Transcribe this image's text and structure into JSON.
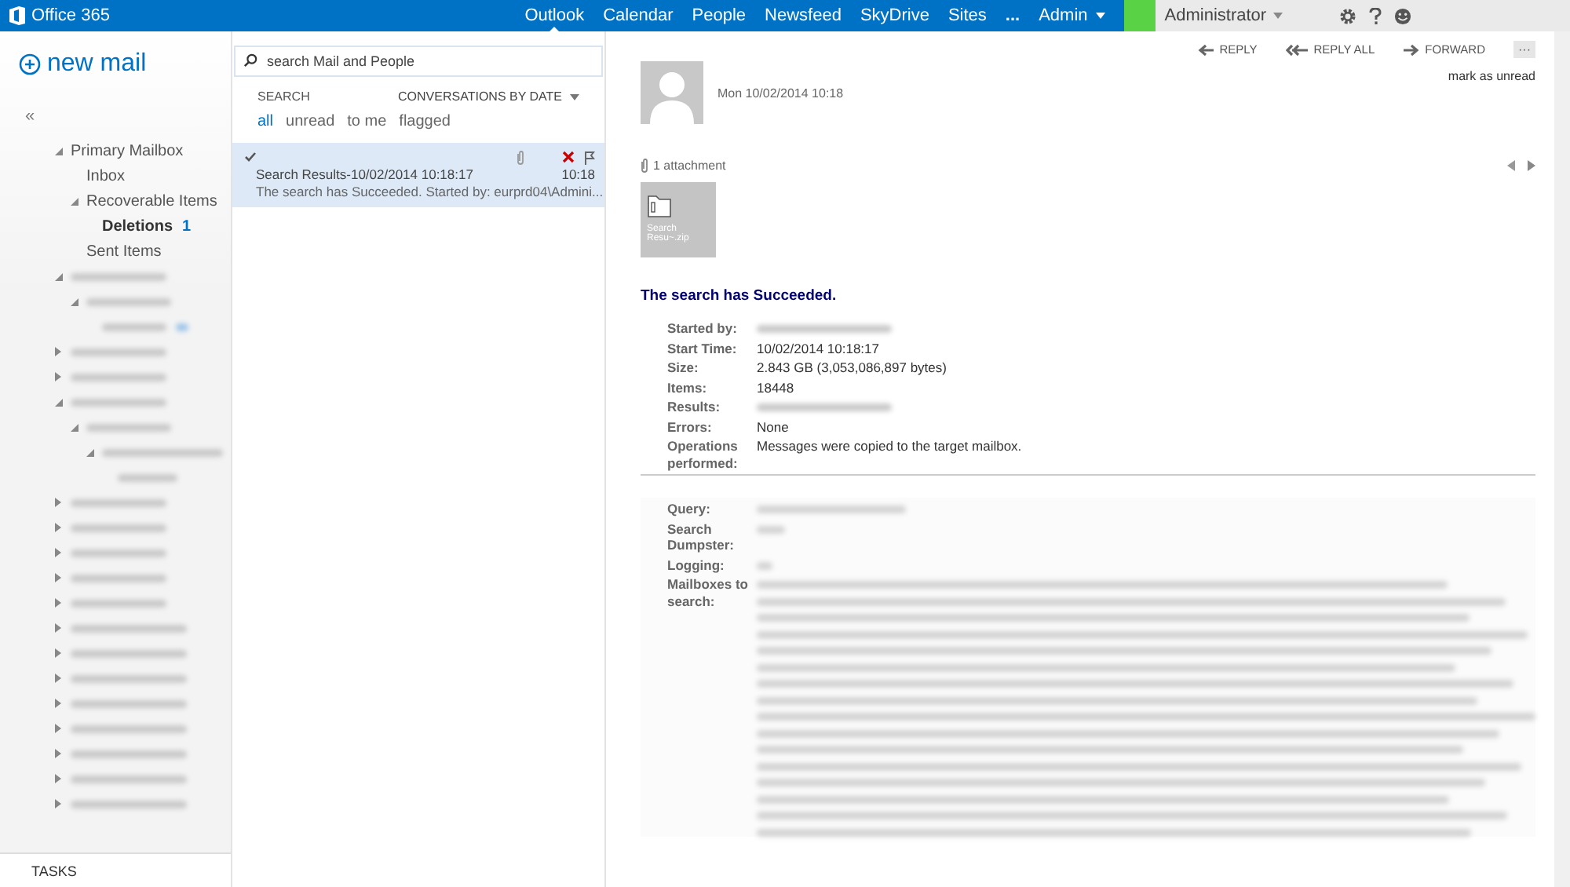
{
  "topbar": {
    "logo": "Office 365",
    "nav": [
      {
        "label": "Outlook",
        "selected": true
      },
      {
        "label": "Calendar",
        "selected": false
      },
      {
        "label": "People",
        "selected": false
      },
      {
        "label": "Newsfeed",
        "selected": false
      },
      {
        "label": "SkyDrive",
        "selected": false
      },
      {
        "label": "Sites",
        "selected": false
      },
      {
        "label": "...",
        "selected": false
      },
      {
        "label": "Admin",
        "selected": false
      }
    ],
    "user": "Administrator"
  },
  "sidebar": {
    "new_mail": "new mail",
    "collapse": "«",
    "folders": [
      {
        "kind": "folder",
        "label": "Primary Mailbox",
        "expanded": true,
        "children": [
          {
            "kind": "folder",
            "label": "Inbox"
          },
          {
            "kind": "folder",
            "label": "Recoverable Items",
            "expanded": true,
            "children": [
              {
                "kind": "folder",
                "label": "Deletions",
                "count": "1",
                "selected": true
              }
            ]
          },
          {
            "kind": "folder",
            "label": "Sent Items"
          }
        ]
      },
      {
        "kind": "redacted",
        "expanded": true,
        "children": [
          {
            "kind": "redacted",
            "expanded": true,
            "children": [
              {
                "kind": "redacted",
                "badge": true
              }
            ]
          }
        ]
      },
      {
        "kind": "redacted",
        "expanded": false
      },
      {
        "kind": "redacted",
        "expanded": false
      },
      {
        "kind": "redacted",
        "expanded": true,
        "children": [
          {
            "kind": "redacted",
            "expanded": true,
            "children": [
              {
                "kind": "redacted",
                "expanded": true,
                "children": [
                  {
                    "kind": "redacted"
                  }
                ]
              }
            ]
          }
        ]
      },
      {
        "kind": "redacted",
        "expanded": false
      },
      {
        "kind": "redacted",
        "expanded": false
      },
      {
        "kind": "redacted",
        "expanded": false
      },
      {
        "kind": "redacted",
        "expanded": false
      },
      {
        "kind": "redacted",
        "expanded": false
      },
      {
        "kind": "redacted",
        "expanded": false
      },
      {
        "kind": "redacted",
        "expanded": false
      },
      {
        "kind": "redacted",
        "expanded": false
      },
      {
        "kind": "redacted",
        "expanded": false
      },
      {
        "kind": "redacted",
        "expanded": false
      },
      {
        "kind": "redacted",
        "expanded": false
      },
      {
        "kind": "redacted",
        "expanded": false
      },
      {
        "kind": "redacted",
        "expanded": false
      }
    ],
    "tasks": "TASKS"
  },
  "message_list": {
    "search": {
      "placeholder": "search Mail and People"
    },
    "heading": "SEARCH",
    "sort": "CONVERSATIONS BY DATE",
    "filters": [
      {
        "label": "all",
        "selected": true
      },
      {
        "label": "unread",
        "selected": false
      },
      {
        "label": "to me",
        "selected": false
      },
      {
        "label": "flagged",
        "selected": false
      }
    ],
    "messages": [
      {
        "subject": "Search Results-10/02/2014 10:18:17",
        "time": "10:18",
        "preview": "The search has Succeeded.  Started by: eurprd04\\Admini...",
        "selected": true,
        "read": true,
        "attachment": true
      }
    ]
  },
  "reading_pane": {
    "actions": [
      "REPLY",
      "REPLY ALL",
      "FORWARD"
    ],
    "mark_unread": "mark as unread",
    "date": "Mon 10/02/2014 10:18",
    "attachments_label": "1 attachment",
    "attachment": "Search Resu~.zip",
    "heading": "The search has Succeeded.",
    "details": [
      {
        "label": "Started by:",
        "kind": "redacted"
      },
      {
        "label": "Start Time:",
        "kind": "text",
        "value": "10/02/2014 10:18:17"
      },
      {
        "label": "Size:",
        "kind": "text",
        "value": "2.843 GB (3,053,086,897 bytes)"
      },
      {
        "label": "Items:",
        "kind": "text",
        "value": "18448"
      },
      {
        "label": "Results:",
        "kind": "redacted"
      },
      {
        "label": "Errors:",
        "kind": "text",
        "value": "None"
      },
      {
        "label": "Operations performed:",
        "kind": "text",
        "value": "Messages were copied to the target mailbox."
      }
    ],
    "query": [
      {
        "label": "Query:",
        "kind": "line"
      },
      {
        "label": "Search Dumpster:",
        "kind": "line"
      },
      {
        "label": "Logging:",
        "kind": "line"
      },
      {
        "label": "Mailboxes to search:",
        "kind": "paragraph"
      }
    ],
    "more": "···"
  }
}
